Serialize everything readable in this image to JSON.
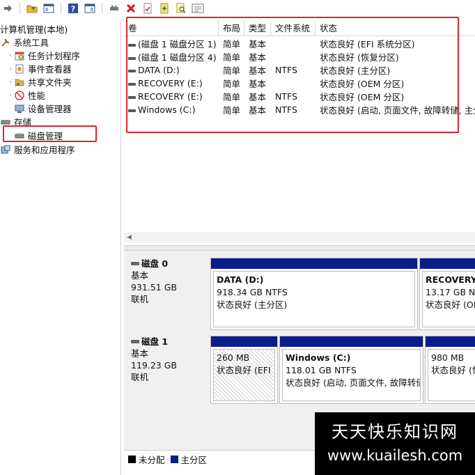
{
  "toolbar": {
    "icons": [
      "forward-icon",
      "folder-up-icon",
      "show-tree-icon",
      "help-icon",
      "show-pane-icon",
      "connect-disk-icon",
      "delete-icon",
      "check-disk-icon",
      "new-volume-icon",
      "find-icon",
      "properties-icon"
    ]
  },
  "tree": {
    "root": "计算机管理(本地)",
    "system_tools": "系统工具",
    "task_scheduler": "任务计划程序",
    "event_viewer": "事件查看器",
    "shared_folders": "共享文件夹",
    "performance": "性能",
    "device_manager": "设备管理器",
    "storage": "存储",
    "disk_management": "磁盘管理",
    "services_apps": "服务和应用程序"
  },
  "volume_list": {
    "columns": [
      "卷",
      "布局",
      "类型",
      "文件系统",
      "状态"
    ],
    "rows": [
      {
        "volume": "(磁盘 1 磁盘分区 1)",
        "layout": "简单",
        "type": "基本",
        "fs": "",
        "status": "状态良好 (EFI 系统分区)"
      },
      {
        "volume": "(磁盘 1 磁盘分区 4)",
        "layout": "简单",
        "type": "基本",
        "fs": "",
        "status": "状态良好 (恢复分区)"
      },
      {
        "volume": "DATA (D:)",
        "layout": "简单",
        "type": "基本",
        "fs": "NTFS",
        "status": "状态良好 (主分区)"
      },
      {
        "volume": "RECOVERY (E:)",
        "layout": "简单",
        "type": "基本",
        "fs": "",
        "status": "状态良好 (OEM 分区)"
      },
      {
        "volume": "RECOVERY (E:)",
        "layout": "简单",
        "type": "基本",
        "fs": "NTFS",
        "status": "状态良好 (OEM 分区)"
      },
      {
        "volume": "Windows (C:)",
        "layout": "简单",
        "type": "基本",
        "fs": "NTFS",
        "status": "状态良好 (启动, 页面文件, 故障转储, 主分"
      }
    ]
  },
  "disks": [
    {
      "name": "磁盘 0",
      "kind": "基本",
      "size": "931.51 GB",
      "state": "联机",
      "partitions": [
        {
          "name": "DATA  (D:)",
          "size": "918.34 GB NTFS",
          "status": "状态良好 (主分区)"
        },
        {
          "name": "RECOVERY",
          "size": "13.17 GB NTFS",
          "status": "状态良好 (OEM"
        }
      ]
    },
    {
      "name": "磁盘 1",
      "kind": "基本",
      "size": "119.23 GB",
      "state": "联机",
      "partitions": [
        {
          "name": "",
          "size": "260 MB",
          "status": "状态良好 (EFI 系"
        },
        {
          "name": "Windows  (C:)",
          "size": "118.01 GB NTFS",
          "status": "状态良好 (启动, 页面文件, 故障转储"
        },
        {
          "name": "",
          "size": "980 MB",
          "status": "状态良好 (恢"
        }
      ]
    }
  ],
  "legend": {
    "unallocated": "未分配",
    "primary": "主分区",
    "unallocated_color": "#000000",
    "primary_color": "#0c1c8c"
  },
  "watermark": {
    "line1": "天天快乐知识网",
    "line2": "www.kuailesh.com"
  },
  "colors": {
    "highlight_box": "#d9262b",
    "partition_bar": "#0c1c8c"
  }
}
